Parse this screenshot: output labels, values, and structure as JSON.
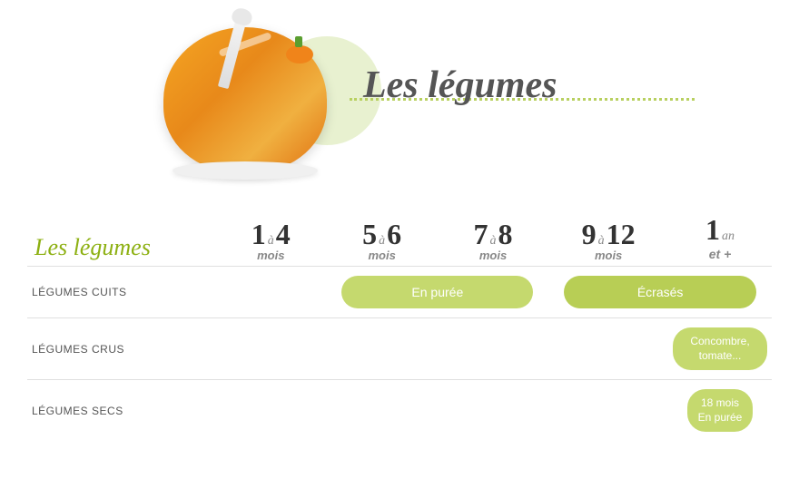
{
  "header": {
    "title": "Les légumes",
    "dotted_line": true
  },
  "section_title": "Les légumes",
  "columns": [
    {
      "id": "label",
      "label": ""
    },
    {
      "id": "1to4",
      "num1": "1",
      "sep": "à",
      "num2": "4",
      "sub": "mois"
    },
    {
      "id": "5to6",
      "num1": "5",
      "sep": "à",
      "num2": "6",
      "sub": "mois"
    },
    {
      "id": "7to8",
      "num1": "7",
      "sep": "à",
      "num2": "8",
      "sub": "mois"
    },
    {
      "id": "9to12",
      "num1": "9",
      "sep": "à",
      "num2": "12",
      "sub": "mois"
    },
    {
      "id": "1an",
      "num1": "1",
      "sub": "an",
      "extra": "et +"
    }
  ],
  "rows": [
    {
      "label": "LÉGUMES CUITS",
      "cells": {
        "1to4": "",
        "5to6_7to8": "En purée",
        "9to12_": "Écrasés",
        "1an": ""
      }
    },
    {
      "label": "LÉGUMES CRUS",
      "cells": {
        "1to4": "",
        "5to6": "",
        "7to8": "",
        "9to12": "",
        "1an": "Concombre, tomate..."
      }
    },
    {
      "label": "LÉGUMES SECS",
      "cells": {
        "1to4": "",
        "5to6": "",
        "7to8": "",
        "9to12": "",
        "1an": "18 mois\nEn purée"
      }
    }
  ],
  "pills": {
    "en_puree": "En purée",
    "ecrases": "Écrasés",
    "concombre": "Concombre, tomate...",
    "18mois": "18 mois\nEn purée"
  }
}
